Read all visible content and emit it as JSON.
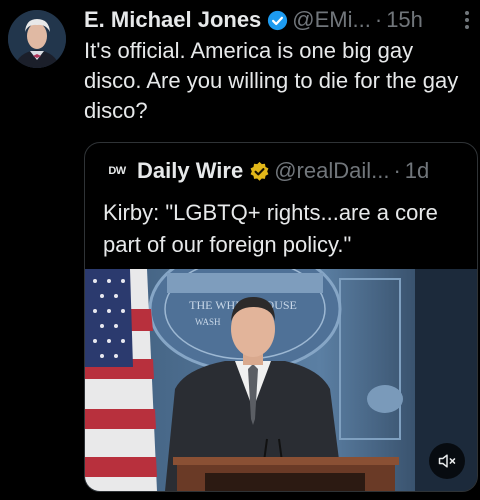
{
  "tweet": {
    "author_name": "E. Michael Jones",
    "handle": "@EMi...",
    "separator": "·",
    "time": "15h",
    "text": "It's official. America is one big gay disco. Are you willing to die for the gay disco?"
  },
  "quoted_tweet": {
    "logo_text": "DW",
    "author_name": "Daily Wire",
    "handle": "@realDail...",
    "separator": "·",
    "time": "1d",
    "text": "Kirby: \"LGBTQ+ rights...are a core part of our foreign policy.\"",
    "media": {
      "seal_text_top": "THE WHITE HOUSE",
      "seal_text_bottom": "WASH"
    }
  },
  "icons": {
    "verified": "verified-badge-icon",
    "verified_business": "gold-verified-badge-icon",
    "more": "more-dots-icon",
    "mute": "volume-muted-icon"
  },
  "colors": {
    "background": "#000000",
    "text": "#e7e9ea",
    "secondary_text": "#71767b",
    "verified_blue": "#1d9bf0",
    "verified_gold": "#e2b719"
  }
}
